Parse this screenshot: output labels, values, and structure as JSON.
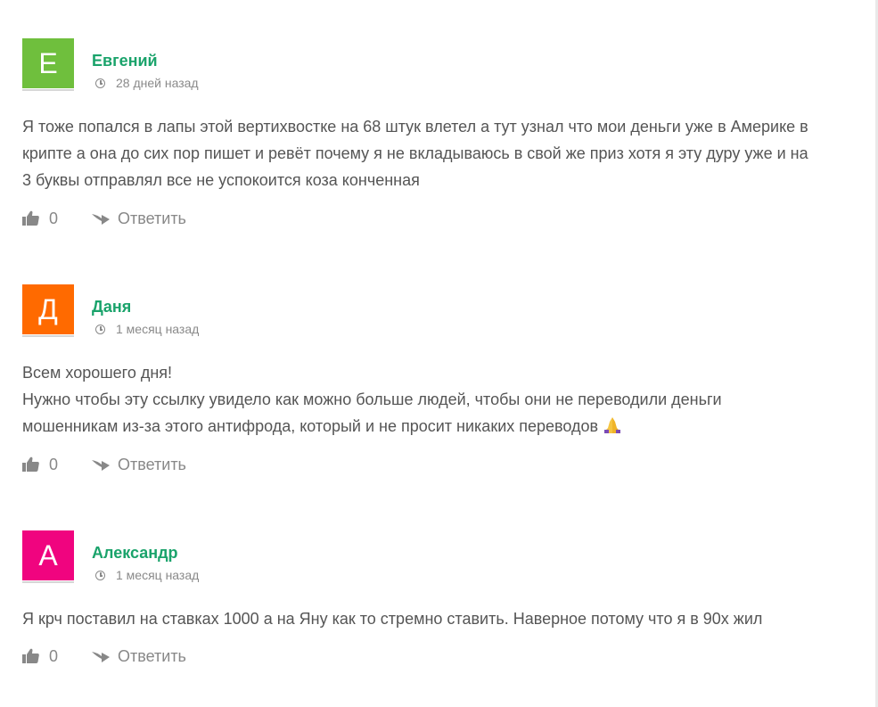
{
  "comments": [
    {
      "avatar_letter": "Е",
      "avatar_color": "#6fbf3d",
      "author": "Евгений",
      "time": "28 дней назад",
      "text_lines": [
        "Я тоже попался в лапы этой вертихвостке на 68 штук влетел а тут узнал что мои деньги уже в Америке в",
        "крипте а она до сих пор пишет и ревёт почему я не вкладываюсь в свой же приз хотя я эту дуру уже и на",
        "3 буквы отправлял все не успокоится коза конченная"
      ],
      "likes": "0",
      "reply_label": "Ответить"
    },
    {
      "avatar_letter": "Д",
      "avatar_color": "#ff6a00",
      "author": "Даня",
      "time": "1 месяц назад",
      "text_lines": [
        "Всем хорошего дня!",
        "Нужно чтобы эту ссылку увидело как можно больше людей, чтобы они не переводили деньги",
        "мошенникам из-за этого антифрода, который и не просит никаких переводов"
      ],
      "likes": "0",
      "reply_label": "Ответить"
    },
    {
      "avatar_letter": "А",
      "avatar_color": "#f0047f",
      "author": "Александр",
      "time": "1 месяц назад",
      "text_lines": [
        "Я крч поставил на ставках 1000 а на Яну как то стремно ставить. Наверное потому что я в 90х жил"
      ],
      "likes": "0",
      "reply_label": "Ответить"
    }
  ],
  "colors": {
    "author": "#1aa36b",
    "meta": "#8a8a8a",
    "text": "#555555"
  },
  "icons": {
    "clock": "clock-icon",
    "like": "thumbs-up-icon",
    "reply": "reply-arrow-icon",
    "emoji": "praying-hands-emoji"
  }
}
